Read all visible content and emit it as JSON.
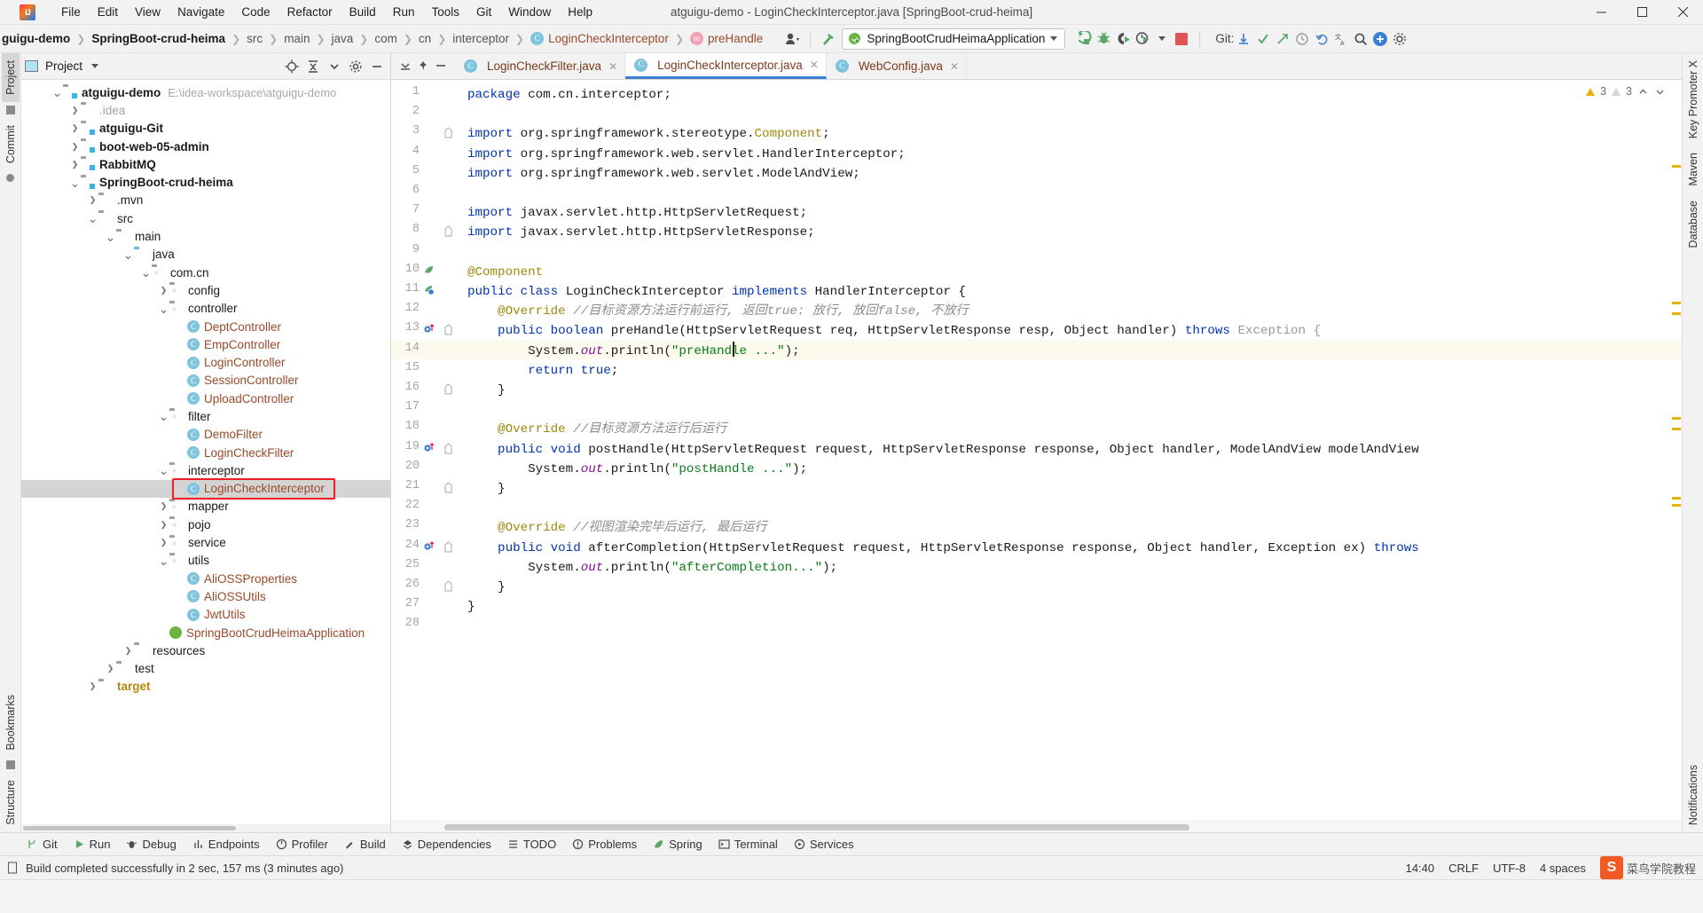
{
  "window": {
    "title": "atguigu-demo - LoginCheckInterceptor.java [SpringBoot-crud-heima]",
    "minimize": "—",
    "maximize": "▢",
    "close": "✕"
  },
  "menubar": [
    {
      "label": "File"
    },
    {
      "label": "Edit"
    },
    {
      "label": "View"
    },
    {
      "label": "Navigate"
    },
    {
      "label": "Code"
    },
    {
      "label": "Refactor"
    },
    {
      "label": "Build"
    },
    {
      "label": "Run"
    },
    {
      "label": "Tools"
    },
    {
      "label": "Git"
    },
    {
      "label": "Window"
    },
    {
      "label": "Help"
    }
  ],
  "breadcrumbs": [
    {
      "label": "guigu-demo",
      "style": "bold"
    },
    {
      "label": "SpringBoot-crud-heima",
      "style": "bold"
    },
    {
      "label": "src",
      "style": "plain"
    },
    {
      "label": "java",
      "style": "plain"
    },
    {
      "label": "main",
      "style": "plain"
    },
    {
      "label": "com",
      "style": "plain"
    },
    {
      "label": "cn",
      "style": "plain"
    },
    {
      "label": "interceptor",
      "style": "plain"
    },
    {
      "label": "LoginCheckInterceptor",
      "style": "class",
      "icon": "C"
    },
    {
      "label": "preHandle",
      "style": "method",
      "icon": "m"
    }
  ],
  "toolbar": {
    "run_config": "SpringBootCrudHeimaApplication",
    "run_config_icon": "spring-boot-icon",
    "icons": [
      {
        "name": "profile-icon"
      },
      {
        "name": "hammer-build-icon"
      },
      {
        "name": "run-icon"
      },
      {
        "name": "debug-icon"
      },
      {
        "name": "run-with-coverage-icon"
      },
      {
        "name": "profiler-run-icon"
      },
      {
        "name": "stop-icon"
      }
    ],
    "git_label": "Git:",
    "git_icons": [
      {
        "name": "git-update-icon"
      },
      {
        "name": "git-commit-icon"
      },
      {
        "name": "git-push-icon"
      },
      {
        "name": "git-history-icon"
      },
      {
        "name": "undo-icon"
      },
      {
        "name": "translate-icon"
      },
      {
        "name": "search-icon"
      },
      {
        "name": "account-icon"
      },
      {
        "name": "settings-icon"
      }
    ]
  },
  "left_rail": [
    {
      "label": "Project",
      "active": true
    },
    {
      "label": "Commit",
      "active": false
    },
    {
      "label": "Bookmarks",
      "active": false
    },
    {
      "label": "Structure",
      "active": false
    }
  ],
  "right_rail": [
    {
      "label": "Key Promoter X"
    },
    {
      "label": "Maven"
    },
    {
      "label": "Database"
    },
    {
      "label": "Notifications"
    }
  ],
  "project_panel": {
    "title": "Project",
    "icons": [
      {
        "name": "select-opened-file-icon"
      },
      {
        "name": "collapse-all-icon"
      },
      {
        "name": "expand-all-icon"
      },
      {
        "name": "settings-gear-icon"
      },
      {
        "name": "hide-panel-icon"
      }
    ],
    "tree": [
      {
        "depth": 0,
        "arrow": "down",
        "icon": "module",
        "label": "atguigu-demo",
        "bold": true,
        "path": "E:\\idea-workspace\\atguigu-demo"
      },
      {
        "depth": 1,
        "arrow": "right",
        "icon": "folder",
        "label": ".idea",
        "dim": true
      },
      {
        "depth": 1,
        "arrow": "right",
        "icon": "module",
        "label": "atguigu-Git",
        "bold": true
      },
      {
        "depth": 1,
        "arrow": "right",
        "icon": "module",
        "label": "boot-web-05-admin",
        "bold": true
      },
      {
        "depth": 1,
        "arrow": "right",
        "icon": "module",
        "label": "RabbitMQ",
        "bold": true
      },
      {
        "depth": 1,
        "arrow": "down",
        "icon": "module",
        "label": "SpringBoot-crud-heima",
        "bold": true
      },
      {
        "depth": 2,
        "arrow": "right",
        "icon": "folder",
        "label": ".mvn"
      },
      {
        "depth": 2,
        "arrow": "down",
        "icon": "folder",
        "label": "src"
      },
      {
        "depth": 3,
        "arrow": "down",
        "icon": "folder",
        "label": "main"
      },
      {
        "depth": 4,
        "arrow": "down",
        "icon": "folder-blue",
        "label": "java"
      },
      {
        "depth": 5,
        "arrow": "down",
        "icon": "package",
        "label": "com.cn"
      },
      {
        "depth": 6,
        "arrow": "right",
        "icon": "package",
        "label": "config"
      },
      {
        "depth": 6,
        "arrow": "down",
        "icon": "package",
        "label": "controller"
      },
      {
        "depth": 7,
        "arrow": "none",
        "icon": "class",
        "label": "DeptController",
        "cls": true
      },
      {
        "depth": 7,
        "arrow": "none",
        "icon": "class",
        "label": "EmpController",
        "cls": true
      },
      {
        "depth": 7,
        "arrow": "none",
        "icon": "class",
        "label": "LoginController",
        "cls": true
      },
      {
        "depth": 7,
        "arrow": "none",
        "icon": "class",
        "label": "SessionController",
        "cls": true
      },
      {
        "depth": 7,
        "arrow": "none",
        "icon": "class",
        "label": "UploadController",
        "cls": true
      },
      {
        "depth": 6,
        "arrow": "down",
        "icon": "package",
        "label": "filter"
      },
      {
        "depth": 7,
        "arrow": "none",
        "icon": "class",
        "label": "DemoFilter",
        "cls": true
      },
      {
        "depth": 7,
        "arrow": "none",
        "icon": "class",
        "label": "LoginCheckFilter",
        "cls": true
      },
      {
        "depth": 6,
        "arrow": "down",
        "icon": "package",
        "label": "interceptor"
      },
      {
        "depth": 7,
        "arrow": "none",
        "icon": "class",
        "label": "LoginCheckInterceptor",
        "cls": true,
        "selected": true,
        "highlighted": true
      },
      {
        "depth": 6,
        "arrow": "right",
        "icon": "package",
        "label": "mapper"
      },
      {
        "depth": 6,
        "arrow": "right",
        "icon": "package",
        "label": "pojo"
      },
      {
        "depth": 6,
        "arrow": "right",
        "icon": "package",
        "label": "service"
      },
      {
        "depth": 6,
        "arrow": "down",
        "icon": "package",
        "label": "utils"
      },
      {
        "depth": 7,
        "arrow": "none",
        "icon": "class",
        "label": "AliOSSProperties",
        "cls": true
      },
      {
        "depth": 7,
        "arrow": "none",
        "icon": "class",
        "label": "AliOSSUtils",
        "cls": true
      },
      {
        "depth": 7,
        "arrow": "none",
        "icon": "class",
        "label": "JwtUtils",
        "cls": true
      },
      {
        "depth": 6,
        "arrow": "none",
        "icon": "spring",
        "label": "SpringBootCrudHeimaApplication",
        "cls": true
      },
      {
        "depth": 4,
        "arrow": "right",
        "icon": "folder",
        "label": "resources"
      },
      {
        "depth": 3,
        "arrow": "right",
        "icon": "folder",
        "label": "test"
      },
      {
        "depth": 2,
        "arrow": "right",
        "icon": "folder",
        "label": "target",
        "orange": true
      }
    ]
  },
  "editor": {
    "tabs": [
      {
        "label": "LoginCheckFilter.java",
        "active": false
      },
      {
        "label": "LoginCheckInterceptor.java",
        "active": true
      },
      {
        "label": "WebConfig.java",
        "active": false
      }
    ],
    "inspection": {
      "warnings": "3",
      "weak_warnings": "3"
    },
    "current_line": 14,
    "lines": [
      {
        "n": 1,
        "tokens": [
          {
            "t": "package ",
            "c": "kw"
          },
          {
            "t": "com.cn.interceptor;",
            "c": "typ"
          }
        ]
      },
      {
        "n": 2,
        "tokens": []
      },
      {
        "n": 3,
        "tokens": [
          {
            "t": "import ",
            "c": "kw"
          },
          {
            "t": "org.springframework.stereotype.",
            "c": "typ"
          },
          {
            "t": "Component",
            "c": "ann"
          },
          {
            "t": ";",
            "c": "typ"
          }
        ],
        "fold": true
      },
      {
        "n": 4,
        "tokens": [
          {
            "t": "import ",
            "c": "kw"
          },
          {
            "t": "org.springframework.web.servlet.HandlerInterceptor;",
            "c": "typ"
          }
        ]
      },
      {
        "n": 5,
        "tokens": [
          {
            "t": "import ",
            "c": "kw"
          },
          {
            "t": "org.springframework.web.servlet.ModelAndView;",
            "c": "typ"
          }
        ]
      },
      {
        "n": 6,
        "tokens": []
      },
      {
        "n": 7,
        "tokens": [
          {
            "t": "import ",
            "c": "kw"
          },
          {
            "t": "javax.servlet.http.HttpServletRequest;",
            "c": "typ"
          }
        ]
      },
      {
        "n": 8,
        "tokens": [
          {
            "t": "import ",
            "c": "kw"
          },
          {
            "t": "javax.servlet.http.HttpServletResponse;",
            "c": "typ"
          }
        ],
        "fold": true
      },
      {
        "n": 9,
        "tokens": []
      },
      {
        "n": 10,
        "tokens": [
          {
            "t": "@Component",
            "c": "ann"
          }
        ],
        "gutter": "bean-icon"
      },
      {
        "n": 11,
        "tokens": [
          {
            "t": "public class ",
            "c": "kw"
          },
          {
            "t": "LoginCheckInterceptor ",
            "c": "typ"
          },
          {
            "t": "implements ",
            "c": "kw"
          },
          {
            "t": "HandlerInterceptor {",
            "c": "typ"
          }
        ],
        "gutter": "impl-icon"
      },
      {
        "n": 12,
        "tokens": [
          {
            "t": "    @Override ",
            "c": "ann"
          },
          {
            "t": "//目标资源方法运行前运行, 返回true: 放行, 放回false, 不放行",
            "c": "cmt"
          }
        ]
      },
      {
        "n": 13,
        "tokens": [
          {
            "t": "    public boolean ",
            "c": "kw"
          },
          {
            "t": "preHandle(",
            "c": "mth"
          },
          {
            "t": "HttpServletRequest req, HttpServletResponse resp, Object handler) ",
            "c": "typ"
          },
          {
            "t": "throws ",
            "c": "kw"
          },
          {
            "t": "Exception {",
            "c": "grey"
          }
        ],
        "gutter": "override-icon",
        "fold": true
      },
      {
        "n": 14,
        "tokens": [
          {
            "t": "        System.",
            "c": "typ"
          },
          {
            "t": "out",
            "c": "fld"
          },
          {
            "t": ".println(",
            "c": "typ"
          },
          {
            "t": "\"preHandle ...\"",
            "c": "str"
          },
          {
            "t": ");",
            "c": "typ"
          }
        ]
      },
      {
        "n": 15,
        "tokens": [
          {
            "t": "        return true",
            "c": "kw"
          },
          {
            "t": ";",
            "c": "typ"
          }
        ]
      },
      {
        "n": 16,
        "tokens": [
          {
            "t": "    }",
            "c": "typ"
          }
        ],
        "fold": true
      },
      {
        "n": 17,
        "tokens": []
      },
      {
        "n": 18,
        "tokens": [
          {
            "t": "    @Override ",
            "c": "ann"
          },
          {
            "t": "//目标资源方法运行后运行",
            "c": "cmt"
          }
        ]
      },
      {
        "n": 19,
        "tokens": [
          {
            "t": "    public void ",
            "c": "kw"
          },
          {
            "t": "postHandle(",
            "c": "mth"
          },
          {
            "t": "HttpServletRequest request, HttpServletResponse response, Object handler, ModelAndView modelAndView",
            "c": "typ"
          }
        ],
        "gutter": "override-icon",
        "fold": true
      },
      {
        "n": 20,
        "tokens": [
          {
            "t": "        System.",
            "c": "typ"
          },
          {
            "t": "out",
            "c": "fld"
          },
          {
            "t": ".println(",
            "c": "typ"
          },
          {
            "t": "\"postHandle ...\"",
            "c": "str"
          },
          {
            "t": ");",
            "c": "typ"
          }
        ]
      },
      {
        "n": 21,
        "tokens": [
          {
            "t": "    }",
            "c": "typ"
          }
        ],
        "fold": true
      },
      {
        "n": 22,
        "tokens": []
      },
      {
        "n": 23,
        "tokens": [
          {
            "t": "    @Override ",
            "c": "ann"
          },
          {
            "t": "//视图渲染完毕后运行, 最后运行",
            "c": "cmt"
          }
        ]
      },
      {
        "n": 24,
        "tokens": [
          {
            "t": "    public void ",
            "c": "kw"
          },
          {
            "t": "afterCompletion(",
            "c": "mth"
          },
          {
            "t": "HttpServletRequest request, HttpServletResponse response, Object handler, Exception ex) ",
            "c": "typ"
          },
          {
            "t": "throws",
            "c": "kw"
          }
        ],
        "gutter": "override-icon",
        "fold": true
      },
      {
        "n": 25,
        "tokens": [
          {
            "t": "        System.",
            "c": "typ"
          },
          {
            "t": "out",
            "c": "fld"
          },
          {
            "t": ".println(",
            "c": "typ"
          },
          {
            "t": "\"afterCompletion...\"",
            "c": "str"
          },
          {
            "t": ");",
            "c": "typ"
          }
        ]
      },
      {
        "n": 26,
        "tokens": [
          {
            "t": "    }",
            "c": "typ"
          }
        ],
        "fold": true
      },
      {
        "n": 27,
        "tokens": [
          {
            "t": "}",
            "c": "typ"
          }
        ]
      },
      {
        "n": 28,
        "tokens": []
      }
    ]
  },
  "tool_windows": [
    {
      "label": "Git",
      "icon": "git-branch-icon"
    },
    {
      "label": "Run",
      "icon": "run-play-icon"
    },
    {
      "label": "Debug",
      "icon": "debug-bug-icon"
    },
    {
      "label": "Endpoints",
      "icon": "endpoints-icon"
    },
    {
      "label": "Profiler",
      "icon": "profiler-icon"
    },
    {
      "label": "Build",
      "icon": "build-hammer-icon"
    },
    {
      "label": "Dependencies",
      "icon": "dependencies-icon"
    },
    {
      "label": "TODO",
      "icon": "todo-list-icon"
    },
    {
      "label": "Problems",
      "icon": "problems-icon"
    },
    {
      "label": "Spring",
      "icon": "spring-leaf-icon"
    },
    {
      "label": "Terminal",
      "icon": "terminal-icon"
    },
    {
      "label": "Services",
      "icon": "services-icon"
    }
  ],
  "statusbar": {
    "message": "Build completed successfully in 2 sec, 157 ms (3 minutes ago)",
    "position": "14:40",
    "line_separator": "CRLF",
    "encoding": "UTF-8",
    "indent": "4 spaces",
    "watermark": "菜鸟学院教程"
  },
  "colors": {
    "accent": "#3d7fd1",
    "highlight_box": "#ee1c25",
    "keyword": "#0033b3",
    "string": "#067d17",
    "comment": "#8c8c8c",
    "annotation": "#9e880d",
    "class_name": "#9a4a2a",
    "selection": "#d4d4d4"
  }
}
